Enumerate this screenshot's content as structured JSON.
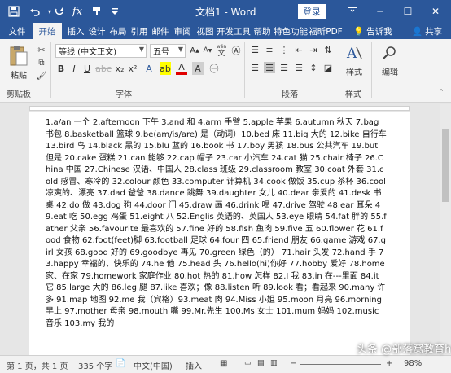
{
  "title_bar": {
    "title": "文档1 - Word",
    "login_label": "登录"
  },
  "tabs": [
    "文件",
    "开始",
    "插入",
    "设计",
    "布局",
    "引用",
    "邮件",
    "审阅",
    "视图",
    "开发工具",
    "帮助",
    "特色功能",
    "福昕PDF"
  ],
  "active_tab": "开始",
  "tell_me": "告诉我",
  "share": "共享",
  "ribbon": {
    "paste_label": "粘贴",
    "clipboard_label": "剪贴板",
    "font_name": "等线 (中文正文)",
    "font_size": "五号",
    "font_group_label": "字体",
    "paragraph_group_label": "段落",
    "styles_label": "样式",
    "styles_group_label": "样式",
    "edit_label": "编辑",
    "font_buttons": [
      "B",
      "I",
      "U",
      "A",
      "A",
      "A"
    ],
    "wen_glyph": "wén"
  },
  "document": {
    "body": "1.a/an 一个 2.afternoon 下午 3.and 和 4.arm 手臂 5.apple 苹果 6.autumn 秋天 7.bag 书包 8.basketball 篮球 9.be(am/is/are) 是（动词）10.bed 床 11.big 大的 12.bike 自行车 13.bird 鸟 14.black 黑的 15.blu 蓝的 16.book 书 17.boy 男孩 18.bus 公共汽车 19.but 但是 20.cake 蛋糕 21.can 能够 22.cap 帽子 23.car 小汽车 24.cat 猫 25.chair 椅子 26.China 中国 27.Chinese 汉语、中国人 28.class 班级 29.classroom 教室 30.coat 外套 31.cold 感冒、寒冷的 32.colour 颜色 33.computer 计算机 34.cook 做饭 35.cup 茶杯 36.cool 凉爽的、漂亮 37.dad 爸爸 38.dance 跳舞 39.daughter 女儿 40.dear 亲爱的 41.desk 书桌 42.do 做 43.dog 狗 44.door 门 45.draw 画 46.drink 喝 47.drive 驾驶 48.ear 耳朵 49.eat 吃 50.egg 鸡蛋 51.eight 八 52.Englis 英语的、英国人 53.eye 眼睛 54.fat 胖的 55.father 父亲 56.favourite 最喜欢的 57.fine 好的 58.fish 鱼肉 59.five 五 60.flower 花 61.food 食物 62.foot(feet)脚 63.football 足球 64.four 四 65.friend 朋友 66.game 游戏 67.girl 女孩 68.good 好的 69.goodbye 再见 70.green 绿色（的） 71.hair 头发 72.hand 手 73.happy 幸福的、快乐的 74.he 他 75.head 头 76.hello(hi)你好 77.hobby 爱好 78.home 家、在家 79.homework 家庭作业 80.hot 热的 81.how 怎样 82.I 我 83.in 在---里面 84.it 它 85.large 大的 86.leg 腿 87.like 喜欢；像 88.listen 听 89.look 看；看起来 90.many 许多 91.map 地图 92.me 我（宾格）93.meat 肉 94.Miss 小姐 95.moon 月亮 96.morning 早上 97.mother 母亲 98.mouth 嘴 99.Mr.先生 100.Ms 女士 101.mum 妈妈 102.music 音乐 103.my 我的"
  },
  "status_bar": {
    "page": "第 1 页，共 1 页",
    "words": "335 个字",
    "language": "中文(中国)",
    "mode": "插入",
    "zoom": "98%"
  },
  "watermark": "头条 @部落窝教育h",
  "colors": {
    "brand": "#2b579a",
    "ribbon_bg": "#f3f3f3",
    "canvas_bg": "#e6e6e6"
  },
  "icons": [
    "save-icon",
    "undo-icon",
    "redo-icon",
    "fx-icon",
    "format-painter-icon",
    "customize-icon",
    "ribbon-display-icon",
    "minimize-icon",
    "maximize-icon",
    "close-icon",
    "lightbulb-icon",
    "person-icon",
    "paste-icon",
    "cut-icon",
    "copy-icon",
    "styles-icon",
    "search-icon"
  ]
}
